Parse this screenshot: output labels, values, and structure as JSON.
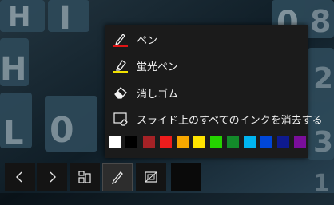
{
  "pen_menu": {
    "items": [
      {
        "label": "ペン",
        "icon": "pen-icon",
        "underline_color": "#e01515"
      },
      {
        "label": "蛍光ペン",
        "icon": "highlighter-icon",
        "underline_color": "#f0e000"
      },
      {
        "label": "消しゴム",
        "icon": "eraser-icon"
      },
      {
        "label": "スライド上のすべてのインクを消去する",
        "icon": "erase-all-ink-icon"
      }
    ],
    "colors": [
      "#ffffff",
      "#000000",
      "#a52226",
      "#ee1c1c",
      "#f7a700",
      "#ffe400",
      "#25d300",
      "#138a2a",
      "#00b4f0",
      "#0047d9",
      "#0e1a8f",
      "#7a0e9b"
    ]
  },
  "toolbar": {
    "buttons": [
      "previous-slide-icon",
      "next-slide-icon",
      "see-all-slides-icon",
      "pen-icon",
      "zoom-icon"
    ],
    "active": "pen-tool-button"
  }
}
